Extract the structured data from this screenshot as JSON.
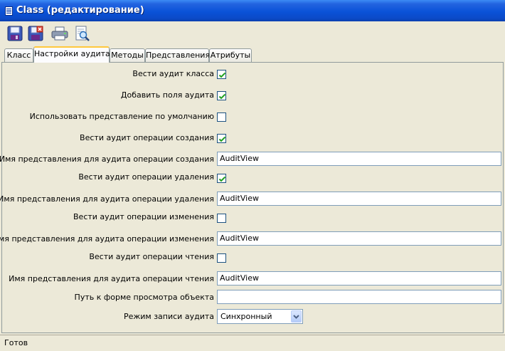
{
  "window": {
    "title": "Class (редактирование)"
  },
  "toolbar": {
    "icons": [
      "save-icon",
      "save-close-icon",
      "print-icon",
      "preview-icon"
    ]
  },
  "tabs": [
    {
      "label": "Класс"
    },
    {
      "label": "Настройки аудита",
      "active": true
    },
    {
      "label": "Методы"
    },
    {
      "label": "Представления"
    },
    {
      "label": "Атрибуты"
    }
  ],
  "form": {
    "audit_class": {
      "label": "Вести аудит класса",
      "checked": true
    },
    "add_audit_fields": {
      "label": "Добавить поля аудита",
      "checked": true
    },
    "use_default_view": {
      "label": "Использовать представление по умолчанию",
      "checked": false
    },
    "audit_create": {
      "label": "Вести аудит операции создания",
      "checked": true
    },
    "create_view": {
      "label": "Имя представления для аудита операции создания",
      "value": "AuditView"
    },
    "audit_delete": {
      "label": "Вести аудит операции удаления",
      "checked": true
    },
    "delete_view": {
      "label": "Имя представления для аудита операции удаления",
      "value": "AuditView"
    },
    "audit_update": {
      "label": "Вести аудит операции изменения",
      "checked": false
    },
    "update_view": {
      "label": "Имя представления для аудита операции изменения",
      "value": "AuditView"
    },
    "audit_read": {
      "label": "Вести аудит операции чтения",
      "checked": false
    },
    "read_view": {
      "label": "Имя представления для аудита операции чтения",
      "value": "AuditView"
    },
    "view_form_path": {
      "label": "Путь к форме просмотра объекта",
      "value": ""
    },
    "write_mode": {
      "label": "Режим записи аудита",
      "value": "Синхронный"
    }
  },
  "status": {
    "text": "Готов"
  },
  "colors": {
    "title_bar": "#0a52d8",
    "check_mark": "#21a121",
    "active_tab_accent": "#ffc83c",
    "window_bg": "#ece9d8"
  }
}
